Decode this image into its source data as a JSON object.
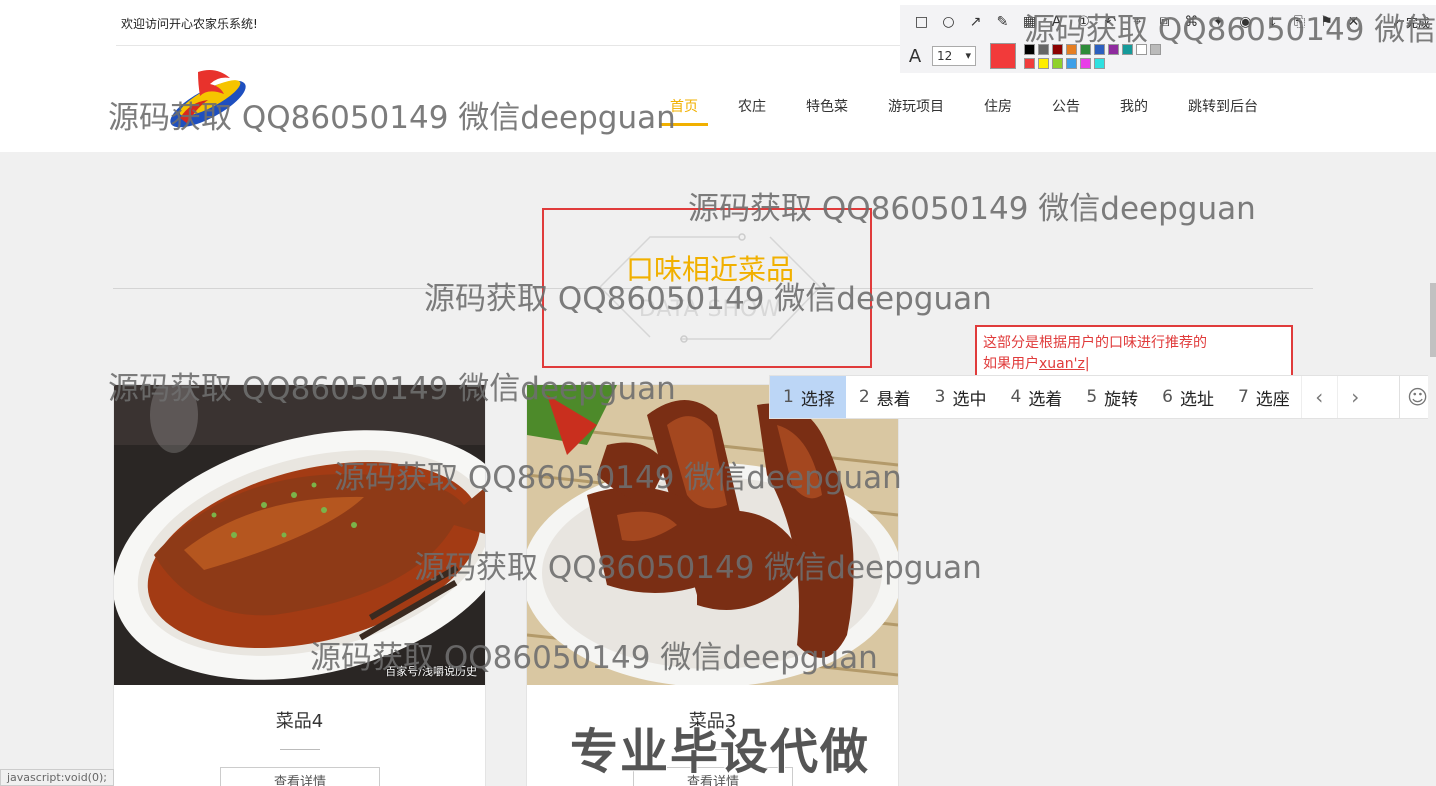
{
  "header": {
    "welcome": "欢迎访问开心农家乐系统!",
    "logo_icon": "farm-logo-icon",
    "nav": [
      {
        "label": "首页",
        "active": true
      },
      {
        "label": "农庄"
      },
      {
        "label": "特色菜"
      },
      {
        "label": "游玩项目"
      },
      {
        "label": "住房"
      },
      {
        "label": "公告"
      },
      {
        "label": "我的"
      },
      {
        "label": "跳转到后台"
      }
    ]
  },
  "section": {
    "title": "口味相近菜品",
    "subtitle": "DATA SHOW"
  },
  "annotation_note": {
    "line1": "这部分是根据用户的口味进行推荐的",
    "line2_prefix": "如果用户",
    "line2_typing": "xuan'z"
  },
  "ime": {
    "candidates": [
      {
        "num": "1",
        "text": "选择",
        "selected": true
      },
      {
        "num": "2",
        "text": "悬着"
      },
      {
        "num": "3",
        "text": "选中"
      },
      {
        "num": "4",
        "text": "选着"
      },
      {
        "num": "5",
        "text": "旋转"
      },
      {
        "num": "6",
        "text": "选址"
      },
      {
        "num": "7",
        "text": "选座"
      }
    ],
    "prev_icon": "chevron-left-icon",
    "next_icon": "chevron-right-icon",
    "emoji_icon": "smiley-icon"
  },
  "cards": [
    {
      "name": "菜品4",
      "detail_label": "查看详情",
      "photo_credit": "百家号/浅嚼说历史"
    },
    {
      "name": "菜品3",
      "detail_label": "查看详情"
    }
  ],
  "annotation_toolbar": {
    "font_size": "12",
    "done_label": "完成",
    "current_color": "#f23a3a",
    "palette": [
      "#000000",
      "#666666",
      "#8b0000",
      "#e67e22",
      "#2e8b3a",
      "#2c5fbf",
      "#8e2b9e",
      "#159a9a",
      "#ffffff",
      "#bbbbbb",
      "#f03c3c",
      "#ffee00",
      "#8fd12a",
      "#3d9fe8",
      "#e83de8",
      "#2ee0e0"
    ]
  },
  "watermark": "源码获取 QQ86050149 微信deepguan",
  "promo": "专业毕设代做",
  "status": "javascript:void(0);",
  "colors": {
    "accent": "#f1b000",
    "annotation_red": "#e03b3b",
    "ime_selected": "#bcd6f6"
  }
}
